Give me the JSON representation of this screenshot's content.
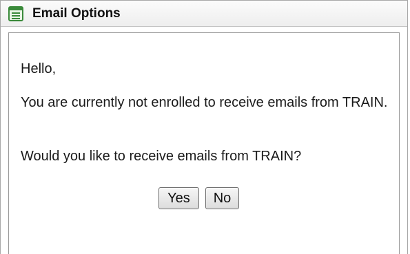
{
  "dialog": {
    "title": "Email Options",
    "title_icon": "document-list-icon",
    "accent": "#3a8a3a"
  },
  "message": {
    "greeting": "Hello,",
    "status": "You are currently not enrolled to receive emails from TRAIN.",
    "question": "Would you like to receive emails from TRAIN?"
  },
  "buttons": {
    "yes_label": "Yes",
    "no_label": "No"
  }
}
